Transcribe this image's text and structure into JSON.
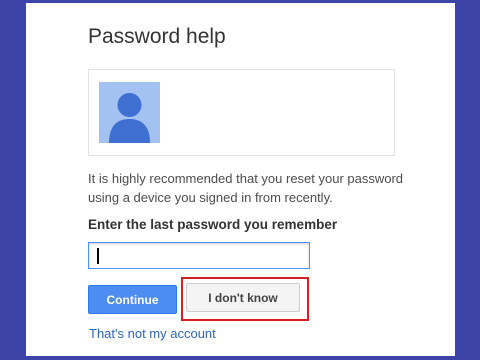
{
  "page": {
    "title": "Password help",
    "info_text": "It is highly recommended that you reset your password using a device you signed in from recently.",
    "field_label": "Enter the last password you remember",
    "password_value": "",
    "continue_label": "Continue",
    "dont_know_label": "I don't know",
    "not_my_account_label": "That's not my account"
  },
  "icons": {
    "avatar": "user-silhouette-icon"
  },
  "colors": {
    "border": "#3d44a8",
    "primary_button": "#4d8cf0",
    "highlight": "#d42020",
    "link": "#2b64c6",
    "avatar_bg": "#a3c2f2",
    "avatar_fg": "#3f6fd0"
  }
}
